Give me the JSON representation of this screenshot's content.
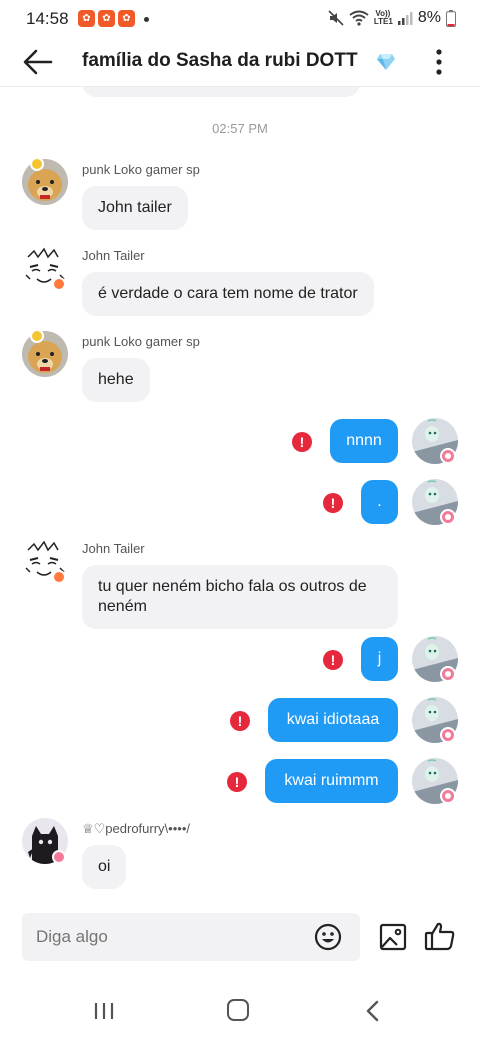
{
  "status_bar": {
    "time": "14:58",
    "notification_icons": [
      "app-notification-icon",
      "app-notification-icon",
      "app-notification-icon"
    ],
    "volte_label": "Vo)) LTE1",
    "battery": "8%"
  },
  "header": {
    "title": "família do Sasha da rubi DOTT",
    "title_icon": "diamond-icon"
  },
  "chat": {
    "time_separator": "02:57 PM",
    "incoming": [
      {
        "sender": "punk Loko gamer sp",
        "text": "John tailer"
      },
      {
        "sender": "John Tailer",
        "text": "é verdade o cara tem nome de trator"
      },
      {
        "sender": "punk Loko gamer sp",
        "text": "hehe"
      },
      {
        "sender": "John Tailer",
        "text": "tu quer neném bicho fala os outros de neném"
      },
      {
        "sender": "♕♡pedrofurry\\••••/",
        "text": "oi"
      }
    ],
    "outgoing": [
      {
        "text": "nnnn",
        "status": "failed"
      },
      {
        "text": ".",
        "status": "failed"
      },
      {
        "text": "j",
        "status": "failed"
      },
      {
        "text": "kwai idiotaaa",
        "status": "failed"
      },
      {
        "text": "kwai ruimmm",
        "status": "failed"
      }
    ],
    "error_symbol": "!"
  },
  "composer": {
    "placeholder": "Diga algo"
  },
  "colors": {
    "accent": "#1f9bf5",
    "error": "#e6283c",
    "incoming_bubble": "#f2f2f4"
  }
}
